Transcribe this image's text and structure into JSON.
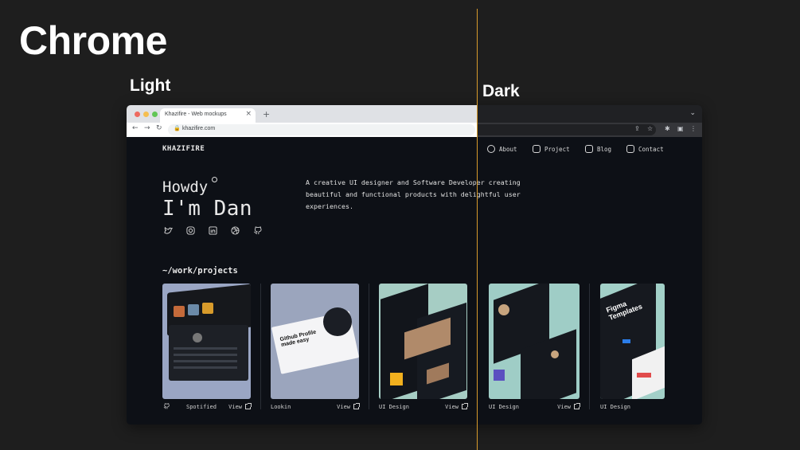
{
  "heading": "Chrome",
  "labels": {
    "light": "Light",
    "dark": "Dark"
  },
  "browser": {
    "tab_title": "Khazifire - Web mockups",
    "tab_close": "×",
    "new_tab": "+",
    "url": "khazifire.com",
    "icons": [
      "back-icon",
      "forward-icon",
      "reload-icon",
      "lock-icon",
      "share-icon",
      "star-icon",
      "extensions-icon",
      "sidebar-icon",
      "menu-icon",
      "chevron-down-icon"
    ],
    "colors": {
      "light_chrome": "#dfe1e5",
      "dark_chrome": "#202124",
      "close": "#ee6a5f",
      "min": "#f5be4f",
      "max": "#62c655"
    }
  },
  "site": {
    "logo": "KHAZIFIRE",
    "nav": [
      "About",
      "Project",
      "Blog",
      "Contact"
    ],
    "howdy": "Howdy",
    "name": "I'm Dan",
    "bio": "A creative UI designer and Software Developer creating beautiful and functional products with delightful user experiences.",
    "socials": [
      "twitter-icon",
      "instagram-icon",
      "linkedin-icon",
      "dribbble-icon",
      "github-icon"
    ],
    "section_title": "~/work/projects",
    "view_label": "View",
    "projects": [
      {
        "category": "Spotified",
        "thumb_color": "#9aa6c4",
        "thumb_text": ""
      },
      {
        "category": "Lookin",
        "thumb_color": "#9ba5bd",
        "thumb_text": "Github Profile made easy"
      },
      {
        "category": "UI Design",
        "thumb_color": "#a6cdc4",
        "thumb_text": ""
      },
      {
        "category": "UI Design",
        "thumb_color": "#9fcdc6",
        "thumb_text": ""
      },
      {
        "category": "UI Design",
        "thumb_color": "#a2d0c8",
        "thumb_text": "Figma Templates"
      }
    ]
  },
  "accent": "#d89b2b"
}
